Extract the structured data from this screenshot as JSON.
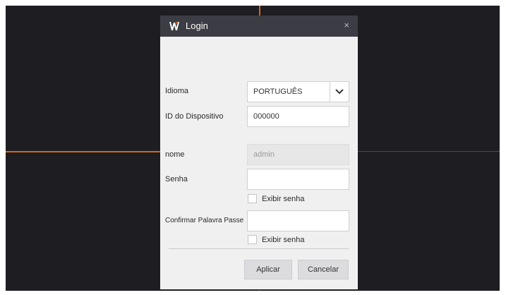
{
  "window": {
    "title": "Login",
    "close_glyph": "×",
    "logo_icon": "wisenet-w-logo",
    "logo_color": "#d8651c"
  },
  "form": {
    "language_label": "Idioma",
    "language_value": "PORTUGUÊS",
    "device_id_label": "ID do Dispositivo",
    "device_id_value": "000000",
    "name_label": "nome",
    "name_value": "admin",
    "password_label": "Senha",
    "password_value": "",
    "show_password_label": "Exibir senha",
    "confirm_label": "Confirmar Palavra Passe",
    "confirm_value": "",
    "show_confirm_label": "Exibir senha"
  },
  "buttons": {
    "apply": "Aplicar",
    "cancel": "Cancelar"
  }
}
